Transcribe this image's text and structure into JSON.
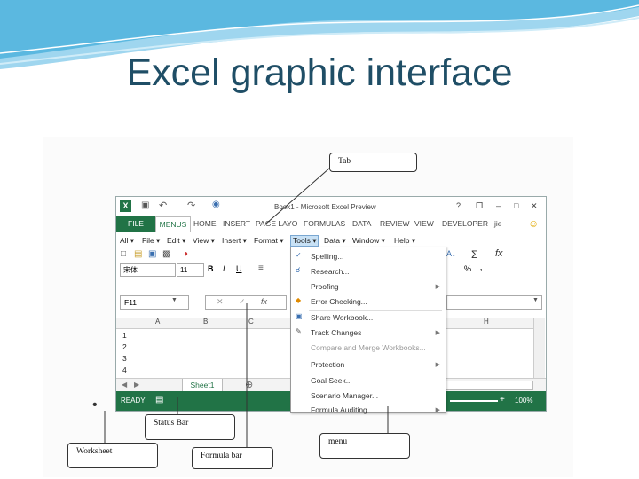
{
  "slide": {
    "title": "Excel graphic interface",
    "bullet": "•"
  },
  "window": {
    "title": "Book1 - Microsoft Excel Preview",
    "controls": [
      "?",
      "❐",
      "–",
      "□",
      "✕"
    ],
    "tabs": {
      "file": "FILE",
      "menus": "MENUS",
      "others": [
        "HOME",
        "INSERT",
        "PAGE LAYO",
        "FORMULAS",
        "DATA",
        "REVIEW",
        "VIEW",
        "DEVELOPER"
      ],
      "user": "jie"
    },
    "menubar": [
      "All ▾",
      "File ▾",
      "Edit ▾",
      "View ▾",
      "Insert ▾",
      "Format ▾",
      "Tools ▾",
      "Data ▾",
      "Window ▾",
      "Help ▾"
    ],
    "font": {
      "name": "宋体",
      "size": "11",
      "bold": "B",
      "italic": "I",
      "underline": "U"
    },
    "namebox": "F11",
    "fx": "fx",
    "columns": [
      "A",
      "B",
      "C",
      "H"
    ],
    "rows": [
      "1",
      "2",
      "3",
      "4"
    ],
    "sheet_tab": "Sheet1",
    "add_sheet": "⊕",
    "status": {
      "ready": "READY",
      "zoom": "100%"
    },
    "tools_menu": [
      {
        "label": "Spelling...",
        "icon": "abc-check-icon"
      },
      {
        "label": "Research...",
        "icon": "research-icon"
      },
      {
        "label": "Proofing",
        "submenu": true
      },
      {
        "label": "Error Checking...",
        "icon": "error-icon"
      },
      {
        "label": "Share Workbook...",
        "icon": "share-icon"
      },
      {
        "label": "Track Changes",
        "submenu": true,
        "icon": "track-icon"
      },
      {
        "label": "Compare and Merge Workbooks...",
        "disabled": true
      },
      {
        "label": "Protection",
        "submenu": true
      },
      {
        "label": "Goal Seek..."
      },
      {
        "label": "Scenario Manager..."
      },
      {
        "label": "Formula Auditing",
        "submenu": true
      }
    ]
  },
  "callouts": {
    "tab": "Tab",
    "status_bar": "Status Bar",
    "worksheet": "Worksheet",
    "formula_bar": "Formula bar",
    "menu": "menu"
  },
  "colors": {
    "excel_green": "#217346",
    "title": "#1f4e66",
    "wave": "#5bb8e0"
  }
}
